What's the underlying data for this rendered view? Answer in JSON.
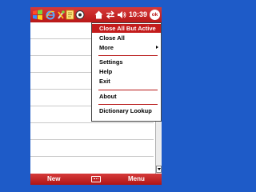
{
  "status_bar": {
    "time": "10:39",
    "ok_label": "ok",
    "icons": [
      "windows-start-icon",
      "internet-explorer-icon",
      "tools-icon",
      "notes-icon",
      "disc-icon",
      "home-icon",
      "sync-icon",
      "volume-icon"
    ]
  },
  "menu": {
    "items": [
      {
        "label": "Close All But Active",
        "selected": true
      },
      {
        "label": "Close All"
      },
      {
        "label": "More",
        "has_submenu": true
      },
      {
        "label": "Settings"
      },
      {
        "label": "Help"
      },
      {
        "label": "Exit"
      },
      {
        "label": "About"
      },
      {
        "label": "Dictionary Lookup"
      }
    ]
  },
  "softkeys": {
    "left": "New",
    "right": "Menu"
  },
  "colors": {
    "accent": "#c31c1c",
    "desktop": "#1e5bc8"
  }
}
